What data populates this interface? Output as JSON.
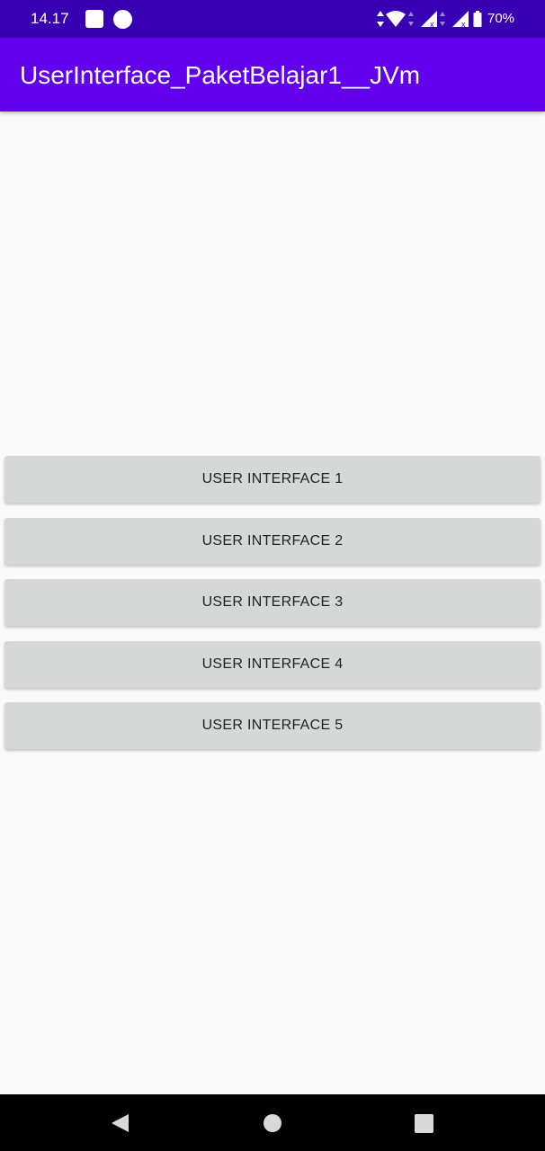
{
  "status_bar": {
    "time": "14.17",
    "battery": "70%",
    "icons": [
      "notification-square-icon",
      "notification-circle-icon",
      "data-arrows-icon",
      "wifi-icon",
      "signal-icon",
      "signal-no-data-icon",
      "battery-icon"
    ]
  },
  "app_bar": {
    "title": "UserInterface_PaketBelajar1__JVm"
  },
  "buttons": [
    {
      "label": "USER INTERFACE 1"
    },
    {
      "label": "USER INTERFACE 2"
    },
    {
      "label": "USER INTERFACE 3"
    },
    {
      "label": "USER INTERFACE 4"
    },
    {
      "label": "USER INTERFACE 5"
    }
  ],
  "nav_bar": {
    "icons": [
      "back-icon",
      "home-icon",
      "recents-icon"
    ]
  },
  "colors": {
    "status_bar": "#3700b3",
    "app_bar": "#6200ee",
    "background": "#fafafa",
    "button": "#d6d7d7",
    "nav_bar": "#000000"
  }
}
